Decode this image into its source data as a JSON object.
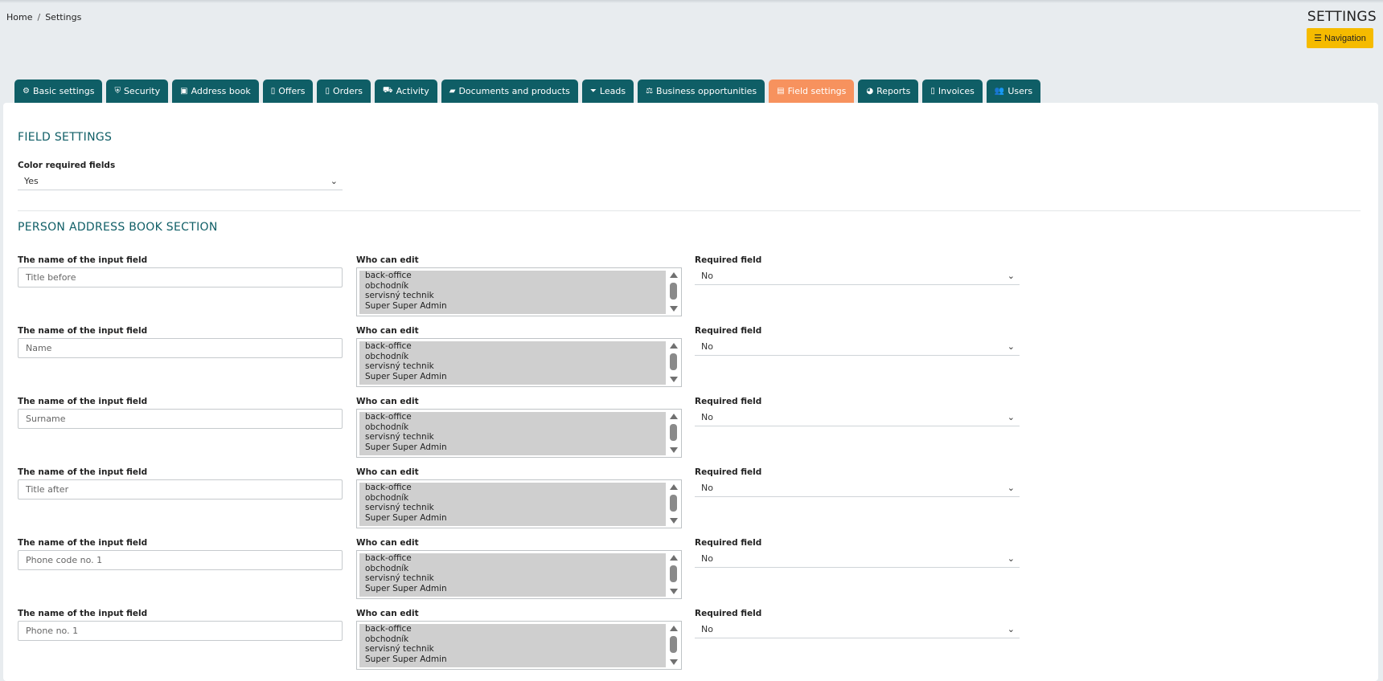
{
  "breadcrumb": [
    "Home",
    "Settings"
  ],
  "breadcrumb_separator": "/",
  "page_title": "SETTINGS",
  "navigation_button": "Navigation",
  "tabs": [
    {
      "label": "Basic settings",
      "icon": "cogs-icon",
      "glyph": "⚙"
    },
    {
      "label": "Security",
      "icon": "shield-icon",
      "glyph": "⛨"
    },
    {
      "label": "Address book",
      "icon": "address-card-icon",
      "glyph": "▣"
    },
    {
      "label": "Offers",
      "icon": "file-icon",
      "glyph": "▯"
    },
    {
      "label": "Orders",
      "icon": "file-icon",
      "glyph": "▯"
    },
    {
      "label": "Activity",
      "icon": "truck-icon",
      "glyph": "⛟"
    },
    {
      "label": "Documents and products",
      "icon": "folder-open-icon",
      "glyph": "▰"
    },
    {
      "label": "Leads",
      "icon": "funnel-icon",
      "glyph": "⏷"
    },
    {
      "label": "Business opportunities",
      "icon": "balance-scale-icon",
      "glyph": "⚖"
    },
    {
      "label": "Field settings",
      "icon": "keyboard-icon",
      "glyph": "▤",
      "active": true
    },
    {
      "label": "Reports",
      "icon": "pie-chart-icon",
      "glyph": "◕"
    },
    {
      "label": "Invoices",
      "icon": "file-icon",
      "glyph": "▯"
    },
    {
      "label": "Users",
      "icon": "users-icon",
      "glyph": "👥"
    }
  ],
  "field_settings": {
    "heading": "FIELD SETTINGS",
    "color_required_label": "Color required fields",
    "color_required_value": "Yes"
  },
  "person_section": {
    "heading": "PERSON ADDRESS BOOK SECTION",
    "col_name_label": "The name of the input field",
    "col_who_label": "Who can edit",
    "col_required_label": "Required field",
    "role_options": [
      "back-office",
      "obchodník",
      "servisný technik",
      "Super Super Admin"
    ],
    "rows": [
      {
        "field": "Title before",
        "required": "No"
      },
      {
        "field": "Name",
        "required": "No"
      },
      {
        "field": "Surname",
        "required": "No"
      },
      {
        "field": "Title after",
        "required": "No"
      },
      {
        "field": "Phone code no. 1",
        "required": "No"
      },
      {
        "field": "Phone no. 1",
        "required": "No"
      }
    ]
  },
  "colors": {
    "tab": "#0f5e66",
    "tab_active": "#f7925e",
    "nav_button": "#f5bb00",
    "heading": "#0f5e66"
  }
}
